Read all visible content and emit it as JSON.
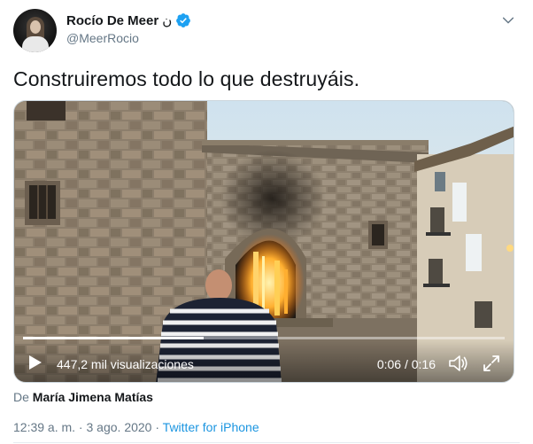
{
  "author": {
    "display_name": "Rocío De Meer",
    "name_suffix": "ن",
    "handle": "@MeerRocio",
    "verified": true
  },
  "tweet": {
    "text": "Construiremos todo lo que destruyáis."
  },
  "video": {
    "views_label": "447,2 mil visualizaciones",
    "current_time": "0:06",
    "duration": "0:16",
    "time_separator": " / ",
    "progress_fraction": 0.375
  },
  "attribution": {
    "prefix": "De",
    "source_name": "María Jimena Matías"
  },
  "meta": {
    "time": "12:39 a. m.",
    "separator": " · ",
    "date": "3 ago. 2020",
    "app": "Twitter for iPhone"
  },
  "colors": {
    "accent": "#1da1f2",
    "link": "#1b95e0",
    "secondary_text": "#657786"
  },
  "icons": [
    "verified-badge-icon",
    "chevron-down-icon",
    "play-icon",
    "volume-icon",
    "fullscreen-icon"
  ]
}
